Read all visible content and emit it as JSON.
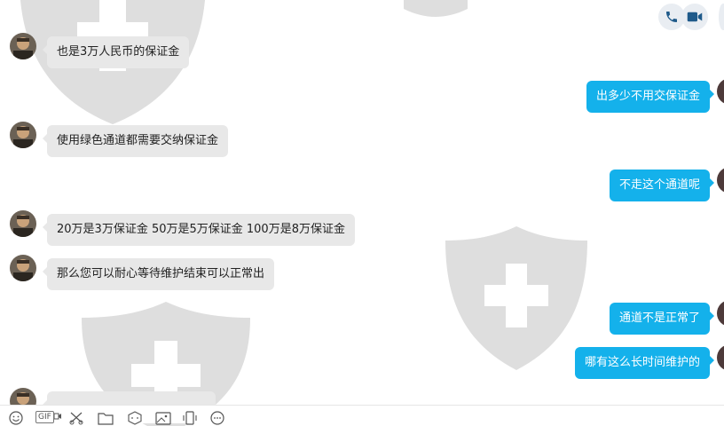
{
  "header": {
    "actions": [
      {
        "icon": "phone-icon",
        "label": "voice call"
      },
      {
        "icon": "video-icon",
        "label": "video call"
      }
    ]
  },
  "messages": [
    {
      "from": "agent",
      "text": "也是3万人民币的保证金"
    },
    {
      "from": "user",
      "text": "出多少不用交保证金"
    },
    {
      "from": "agent",
      "text": "使用绿色通道都需要交纳保证金"
    },
    {
      "from": "user",
      "text": "不走这个通道呢"
    },
    {
      "from": "agent",
      "text": "20万是3万保证金 50万是5万保证金 100万是8万保证金"
    },
    {
      "from": "agent",
      "text": "那么您可以耐心等待维护结束可以正常出"
    },
    {
      "from": "user",
      "text": "通道不是正常了"
    },
    {
      "from": "user",
      "text": "哪有这么长时间维护的"
    },
    {
      "from": "agent",
      "text": ""
    }
  ],
  "toolbar": {
    "gif_label": "GIF",
    "tools": [
      "emoji-icon",
      "gif-icon",
      "scissors-icon",
      "folder-icon",
      "dice-icon",
      "image-icon",
      "shake-icon",
      "more-icon"
    ]
  },
  "colors": {
    "outgoing_bubble": "#14b1eb",
    "incoming_bubble": "#e8e8e8",
    "action_button_bg": "#e9edf2",
    "action_icon": "#1f5a8a",
    "watermark": "#dedede"
  }
}
